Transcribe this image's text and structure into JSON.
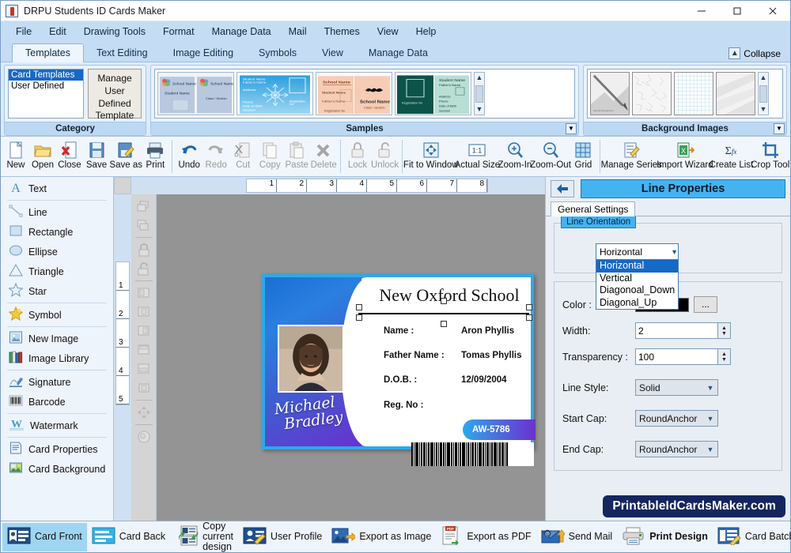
{
  "window": {
    "title": "DRPU Students ID Cards Maker",
    "minimize": "—",
    "maximize": "❐",
    "close": "✕"
  },
  "menu": [
    "File",
    "Edit",
    "Drawing Tools",
    "Format",
    "Manage Data",
    "Mail",
    "Themes",
    "View",
    "Help"
  ],
  "ribbon": {
    "tabs": [
      "Templates",
      "Text Editing",
      "Image Editing",
      "Symbols",
      "View",
      "Manage Data"
    ],
    "active_tab": "Templates",
    "collapse_label": "Collapse",
    "groups": {
      "category": {
        "title": "Category",
        "list": [
          "Card Templates",
          "User Defined"
        ],
        "selected": "Card Templates",
        "manage_button": "Manage User Defined Template"
      },
      "samples": {
        "title": "Samples",
        "thumbs": [
          {
            "name": "sample-blue-grey",
            "fields": [
              "School Name",
              "Student Name",
              "School Name",
              "Class / Section"
            ]
          },
          {
            "name": "sample-blue-snowflake",
            "fields": [
              "Student Name",
              "Father's Name",
              "Address",
              "Phone",
              "Date of Birth",
              "Session",
              "Registration No"
            ]
          },
          {
            "name": "sample-peach-world",
            "fields": [
              "School Name",
              "Student Name",
              "Father's Name",
              "School Name",
              "Class / Section",
              "Registration No"
            ]
          },
          {
            "name": "sample-teal-green",
            "fields": [
              "Student Name",
              "Father's Name",
              "Registration No",
              "Address",
              "Phone",
              "Date of Birth",
              "Session"
            ]
          }
        ]
      },
      "background": {
        "title": "Background Images",
        "thumbs": [
          "bg-pencil-sketch",
          "bg-crackle-texture",
          "bg-blue-grid",
          "bg-soft-paper"
        ]
      }
    }
  },
  "toolbar": [
    {
      "label": "New",
      "icon": "new-page-icon",
      "disabled": false
    },
    {
      "label": "Open",
      "icon": "open-folder-icon",
      "disabled": false
    },
    {
      "label": "Close",
      "icon": "close-file-icon",
      "disabled": false
    },
    {
      "label": "Save",
      "icon": "save-disk-icon",
      "disabled": false
    },
    {
      "label": "Save as",
      "icon": "save-as-icon",
      "disabled": false
    },
    {
      "label": "Print",
      "icon": "printer-icon",
      "disabled": false
    },
    {
      "sep": true
    },
    {
      "label": "Undo",
      "icon": "undo-arrow-icon",
      "disabled": false
    },
    {
      "label": "Redo",
      "icon": "redo-arrow-icon",
      "disabled": true
    },
    {
      "label": "Cut",
      "icon": "scissors-icon",
      "disabled": true
    },
    {
      "label": "Copy",
      "icon": "copy-icon",
      "disabled": true
    },
    {
      "label": "Paste",
      "icon": "paste-icon",
      "disabled": true
    },
    {
      "label": "Delete",
      "icon": "delete-x-icon",
      "disabled": true
    },
    {
      "sep": true
    },
    {
      "label": "Lock",
      "icon": "lock-closed-icon",
      "disabled": true
    },
    {
      "label": "Unlock",
      "icon": "lock-open-icon",
      "disabled": true
    },
    {
      "sep": true
    },
    {
      "label": "Fit to Window",
      "icon": "fit-window-icon",
      "disabled": false
    },
    {
      "label": "Actual Size",
      "icon": "actual-size-icon",
      "disabled": false
    },
    {
      "label": "Zoom-In",
      "icon": "zoom-in-icon",
      "disabled": false
    },
    {
      "label": "Zoom-Out",
      "icon": "zoom-out-icon",
      "disabled": false
    },
    {
      "label": "Grid",
      "icon": "grid-icon",
      "disabled": false
    },
    {
      "sep": true
    },
    {
      "label": "Manage Series",
      "icon": "manage-series-icon",
      "disabled": false
    },
    {
      "label": "Import Wizard",
      "icon": "import-wizard-icon",
      "disabled": false
    },
    {
      "label": "Create List",
      "icon": "create-list-icon",
      "disabled": false
    },
    {
      "label": "Crop Tool",
      "icon": "crop-tool-icon",
      "disabled": false
    }
  ],
  "sidebar": {
    "items": [
      {
        "label": "Text",
        "icon": "text-a-icon"
      },
      {
        "divider": true
      },
      {
        "label": "Line",
        "icon": "line-icon"
      },
      {
        "label": "Rectangle",
        "icon": "rectangle-icon"
      },
      {
        "label": "Ellipse",
        "icon": "ellipse-icon"
      },
      {
        "label": "Triangle",
        "icon": "triangle-icon"
      },
      {
        "label": "Star",
        "icon": "star-icon"
      },
      {
        "divider": true
      },
      {
        "label": "Symbol",
        "icon": "symbol-star-icon"
      },
      {
        "divider": true
      },
      {
        "label": "New Image",
        "icon": "new-image-icon"
      },
      {
        "label": "Image Library",
        "icon": "image-library-icon"
      },
      {
        "divider": true
      },
      {
        "label": "Signature",
        "icon": "signature-pen-icon"
      },
      {
        "label": "Barcode",
        "icon": "barcode-icon"
      },
      {
        "divider": true
      },
      {
        "label": "Watermark",
        "icon": "watermark-w-icon"
      },
      {
        "divider": true
      },
      {
        "label": "Card Properties",
        "icon": "card-properties-icon"
      },
      {
        "label": "Card Background",
        "icon": "card-background-icon"
      }
    ]
  },
  "rulers": {
    "horizontal": [
      "1",
      "2",
      "3",
      "4",
      "5",
      "6",
      "7",
      "8"
    ],
    "vertical": [
      "1",
      "2",
      "3",
      "4",
      "5"
    ]
  },
  "card": {
    "school_name": "New Oxford School",
    "signature_line1": "Michael",
    "signature_line2": "Bradley",
    "fields": [
      {
        "label": "Name :",
        "value": "Aron Phyllis"
      },
      {
        "label": "Father Name :",
        "value": "Tomas Phyllis"
      },
      {
        "label": "D.O.B. :",
        "value": "12/09/2004"
      },
      {
        "label": "Reg. No :",
        "value": ""
      }
    ],
    "reg_no_value": "AW-5786",
    "accent_color": "#2fa8e8",
    "purple_color": "#6b2fd0"
  },
  "properties": {
    "panel_title": "Line Properties",
    "back_icon": "back-arrow-icon",
    "tab": "General Settings",
    "group_legend": "Line Orientation",
    "orientation": {
      "selected": "Horizontal",
      "options": [
        "Horizontal",
        "Vertical",
        "Diagonoal_Down",
        "Diagonal_Up"
      ],
      "open": true
    },
    "color_label": "Color :",
    "color_value": "#000000",
    "color_browse": "...",
    "width_label": "Width:",
    "width_value": "2",
    "transparency_label": "Transparency :",
    "transparency_value": "100",
    "line_style_label": "Line Style:",
    "line_style_value": "Solid",
    "start_cap_label": "Start Cap:",
    "start_cap_value": "RoundAnchor",
    "end_cap_label": "End Cap:",
    "end_cap_value": "RoundAnchor"
  },
  "watermark": "PrintableIdCardsMaker.com",
  "bottombar": [
    {
      "label": "Card Front",
      "icon": "card-front-icon",
      "active": true,
      "bold": false
    },
    {
      "label": "Card Back",
      "icon": "card-back-icon",
      "active": false,
      "bold": false
    },
    {
      "label": "Copy current design",
      "icon": "copy-design-icon",
      "active": false,
      "bold": false
    },
    {
      "label": "User Profile",
      "icon": "user-profile-icon",
      "active": false,
      "bold": false
    },
    {
      "label": "Export as Image",
      "icon": "export-image-icon",
      "active": false,
      "bold": false
    },
    {
      "label": "Export as PDF",
      "icon": "export-pdf-icon",
      "active": false,
      "bold": false
    },
    {
      "label": "Send Mail",
      "icon": "send-mail-icon",
      "active": false,
      "bold": false
    },
    {
      "label": "Print Design",
      "icon": "print-design-icon",
      "active": false,
      "bold": true
    },
    {
      "label": "Card Batch Data",
      "icon": "card-batch-data-icon",
      "active": false,
      "bold": false
    }
  ]
}
